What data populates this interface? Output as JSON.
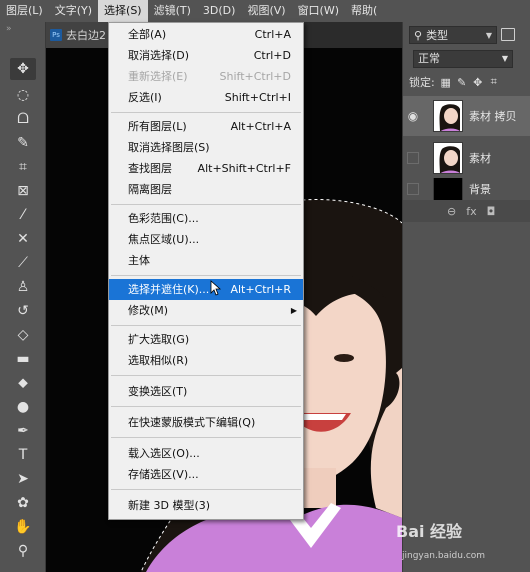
{
  "menubar": {
    "items": [
      "图层(L)",
      "文字(Y)",
      "选择(S)",
      "滤镜(T)",
      "3D(D)",
      "视图(V)",
      "窗口(W)",
      "帮助("
    ]
  },
  "document": {
    "tab_badge": "Ps",
    "tab_title": "去白边2"
  },
  "select_menu": {
    "items": [
      {
        "label": "全部(A)",
        "shortcut": "Ctrl+A"
      },
      {
        "label": "取消选择(D)",
        "shortcut": "Ctrl+D"
      },
      {
        "label": "重新选择(E)",
        "shortcut": "Shift+Ctrl+D"
      },
      {
        "label": "反选(I)",
        "shortcut": "Shift+Ctrl+I"
      },
      {
        "label": "所有图层(L)",
        "shortcut": "Alt+Ctrl+A"
      },
      {
        "label": "取消选择图层(S)",
        "shortcut": ""
      },
      {
        "label": "查找图层",
        "shortcut": "Alt+Shift+Ctrl+F"
      },
      {
        "label": "隔离图层",
        "shortcut": ""
      },
      {
        "label": "色彩范围(C)...",
        "shortcut": ""
      },
      {
        "label": "焦点区域(U)...",
        "shortcut": ""
      },
      {
        "label": "主体",
        "shortcut": ""
      },
      {
        "label": "选择并遮住(K)...",
        "shortcut": "Alt+Ctrl+R"
      },
      {
        "label": "修改(M)",
        "shortcut": ""
      },
      {
        "label": "扩大选取(G)",
        "shortcut": ""
      },
      {
        "label": "选取相似(R)",
        "shortcut": ""
      },
      {
        "label": "变换选区(T)",
        "shortcut": ""
      },
      {
        "label": "在快速蒙版模式下编辑(Q)",
        "shortcut": ""
      },
      {
        "label": "载入选区(O)...",
        "shortcut": ""
      },
      {
        "label": "存储选区(V)...",
        "shortcut": ""
      },
      {
        "label": "新建 3D 模型(3)",
        "shortcut": ""
      }
    ]
  },
  "layers_panel": {
    "filter_label": "类型",
    "blend_mode": "正常",
    "lock_label": "锁定:",
    "layers": [
      {
        "name": "素材 拷贝",
        "visible": true
      },
      {
        "name": "素材",
        "visible": false
      },
      {
        "name": "背景",
        "visible": false
      }
    ],
    "bottom_fx": "fx"
  },
  "watermark": {
    "text": "Bai 经验",
    "url": "jingyan.baidu.com"
  },
  "colors": {
    "menu_highlight": "#1a74d6",
    "panel_bg": "#535353",
    "canvas_bg": "#050505"
  }
}
